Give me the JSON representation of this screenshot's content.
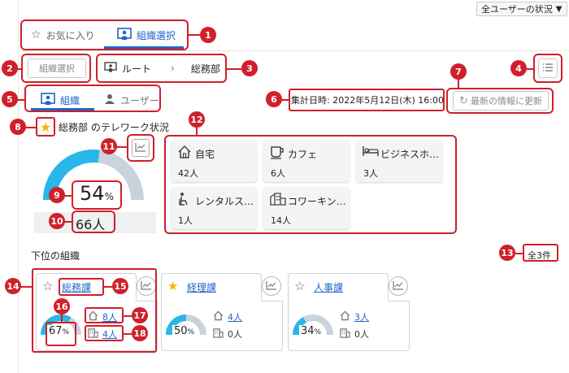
{
  "header": {
    "filter_label": "全ユーザーの状況"
  },
  "tabs": {
    "favorites": "お気に入り",
    "org_select": "組織選択"
  },
  "org_select_button": "組織選択",
  "breadcrumb": {
    "root": "ルート",
    "separator": "›",
    "current": "総務部"
  },
  "view_tabs": {
    "org": "組織",
    "user": "ユーザー"
  },
  "aggregation": {
    "label": "集計日時: 2022年5月12日(木) 16:00"
  },
  "refresh_button": "最新の情報に更新",
  "org_status": {
    "title": "総務部 のテレワーク状況",
    "percent": "54",
    "percent_unit": "%",
    "percent_value": 54,
    "count": "66人"
  },
  "locations": [
    {
      "icon": "home-icon",
      "name": "自宅",
      "count": "42人"
    },
    {
      "icon": "cafe-icon",
      "name": "カフェ",
      "count": "6人"
    },
    {
      "icon": "hotel-icon",
      "name": "ビジネスホ…",
      "count": "3人"
    },
    {
      "icon": "rental-space-icon",
      "name": "レンタルス…",
      "count": "1人"
    },
    {
      "icon": "coworking-icon",
      "name": "コワーキン…",
      "count": "14人"
    }
  ],
  "suborgs": {
    "title": "下位の組織",
    "total": "全3件",
    "items": [
      {
        "name": "総務課",
        "favorite": false,
        "percent": "67",
        "percent_unit": "%",
        "percent_value": 67,
        "home": "8人",
        "office": "4人"
      },
      {
        "name": "経理課",
        "favorite": true,
        "percent": "50",
        "percent_unit": "%",
        "percent_value": 50,
        "home": "4人",
        "office": "0人"
      },
      {
        "name": "人事課",
        "favorite": false,
        "percent": "34",
        "percent_unit": "%",
        "percent_value": 34,
        "home": "3人",
        "office": "0人"
      }
    ]
  },
  "markers": [
    "1",
    "2",
    "3",
    "4",
    "5",
    "6",
    "7",
    "8",
    "9",
    "10",
    "11",
    "12",
    "13",
    "14",
    "15",
    "16",
    "17",
    "18"
  ],
  "colors": {
    "gauge_fill": "#29b6e8",
    "gauge_track": "#c9d3de",
    "accent": "#1e66c8",
    "annotation": "#d0202a",
    "star": "#f5b400"
  }
}
